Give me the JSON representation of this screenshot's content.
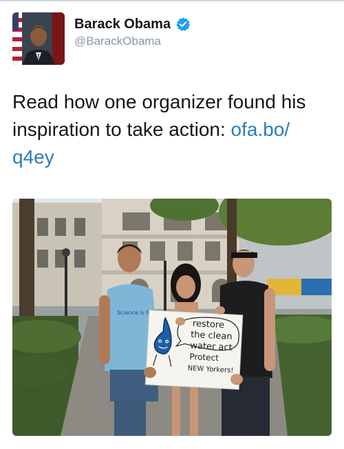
{
  "author": {
    "display_name": "Barack Obama",
    "handle": "@BarackObama",
    "verified": true
  },
  "tweet": {
    "text_before_link": "Read how one organizer found his inspiration to take action: ",
    "link_part1": "ofa.bo/",
    "link_part2": "q4ey"
  },
  "photo": {
    "sign_lines": [
      "restore",
      "the clean",
      "water act",
      "Protect",
      "NEW Yorkers!"
    ],
    "shirt_text": "Science is NOT"
  },
  "colors": {
    "link": "#2b7bb9",
    "verified": "#1da1f2",
    "handle": "#8899a6"
  },
  "icons": {
    "verified": "verified-badge-icon"
  }
}
